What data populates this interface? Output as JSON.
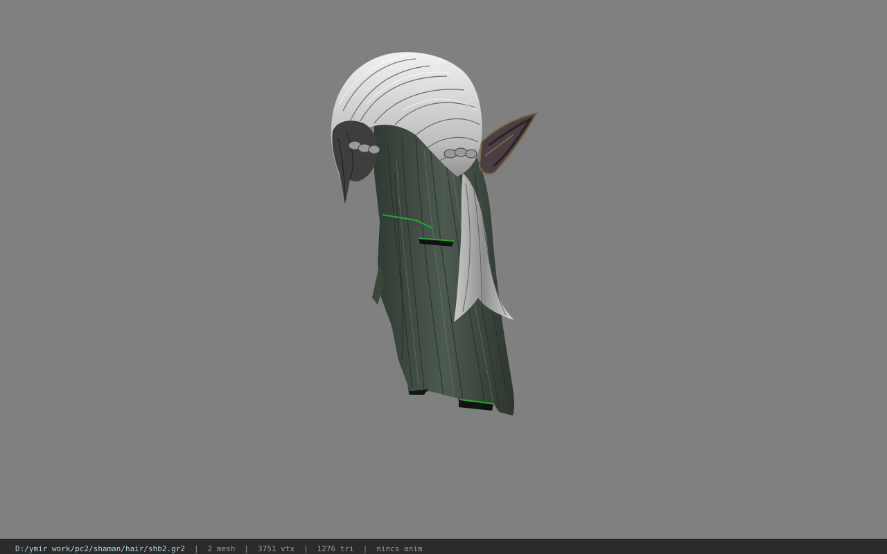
{
  "viewer": {
    "background_color": "#808080",
    "model_icon": "hair-mesh-render"
  },
  "statusbar": {
    "file_path": "D:/ymir work/pc2/shaman/hair/shb2.gr2",
    "separator": "|",
    "mesh_count": "2 mesh",
    "vertex_count": "3751 vtx",
    "triangle_count": "1276 tri",
    "anim_status": "nincs anim",
    "path_color": "#a8d8ea",
    "text_color": "#9a9a9a"
  }
}
